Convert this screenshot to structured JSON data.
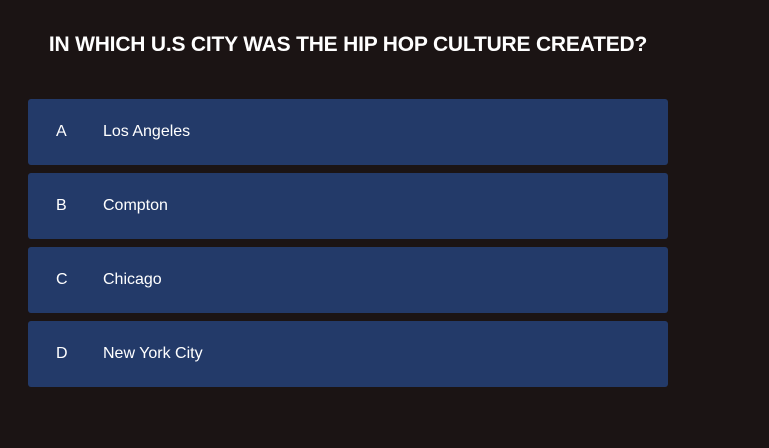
{
  "quiz": {
    "question": "IN WHICH U.S CITY WAS THE HIP HOP CULTURE CREATED?",
    "options": [
      {
        "letter": "A",
        "text": "Los Angeles"
      },
      {
        "letter": "B",
        "text": "Compton"
      },
      {
        "letter": "C",
        "text": "Chicago"
      },
      {
        "letter": "D",
        "text": "New York City"
      }
    ]
  },
  "colors": {
    "background": "#1b1414",
    "option_background": "#233a69",
    "text": "#ffffff"
  }
}
